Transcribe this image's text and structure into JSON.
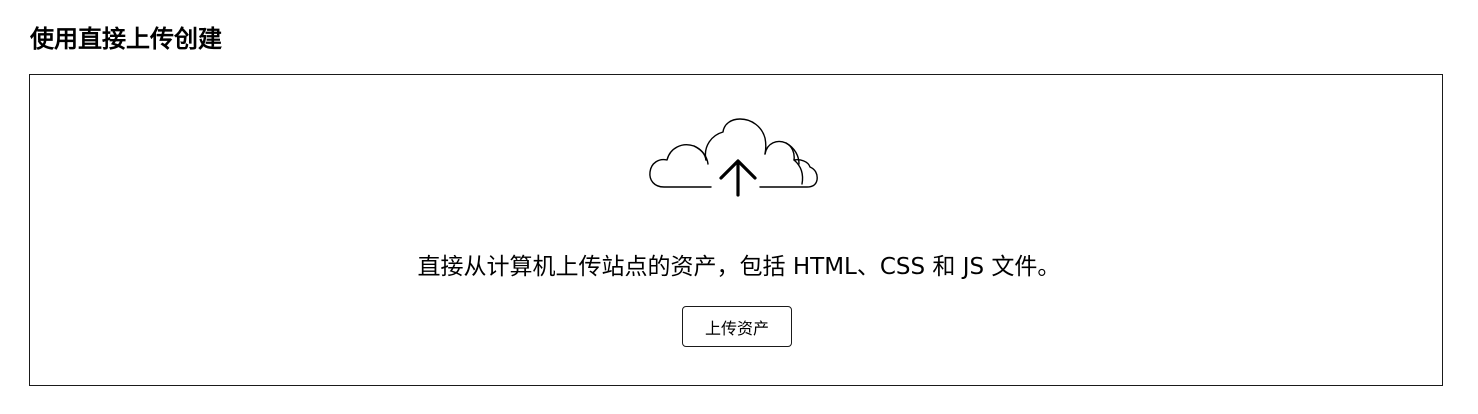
{
  "section": {
    "title": "使用直接上传创建"
  },
  "upload_panel": {
    "icon": "cloud-upload-icon",
    "description": "直接从计算机上传站点的资产，包括 HTML、CSS 和 JS 文件。",
    "button_label": "上传资产"
  }
}
